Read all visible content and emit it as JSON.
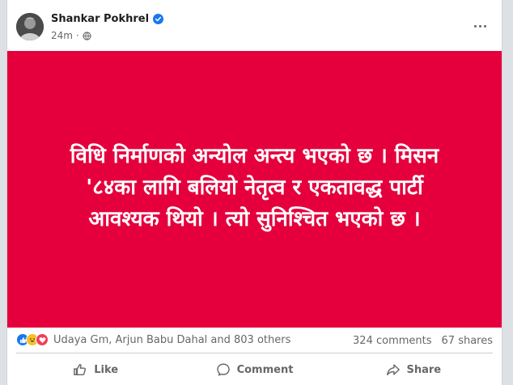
{
  "post": {
    "author": "Shankar Pokhrel",
    "time": "24m",
    "dot": "·",
    "text_lines": [
      "विधि निर्माणको अन्योल अन्त्य भएको छ । मिसन",
      "'८४का लागि बलियो नेतृत्व र एकतावद्ध पार्टी",
      "आवश्यक थियो । त्यो सुनिश्चित भएको छ ।"
    ],
    "background_color": "#e5003d"
  },
  "reactions": {
    "summary": "Udaya Gm, Arjun Babu Dahal and 803 others",
    "icons": [
      "like-icon",
      "haha-icon",
      "love-icon"
    ]
  },
  "stats": {
    "comments": "324 comments",
    "shares": "67 shares"
  },
  "actions": {
    "like": "Like",
    "comment": "Comment",
    "share": "Share"
  }
}
